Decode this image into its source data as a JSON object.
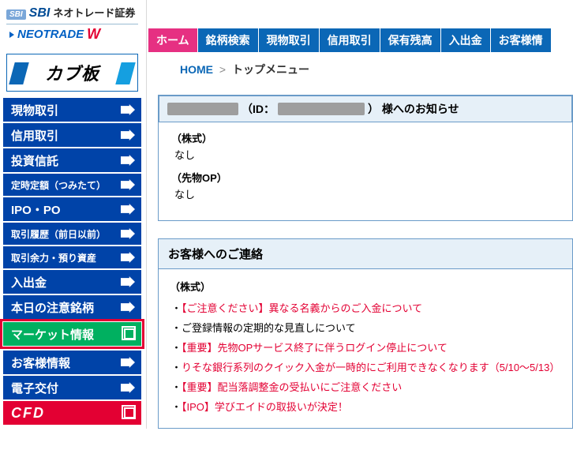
{
  "brand": {
    "mark": "SBI",
    "main": "SBI",
    "jp": "ネオトレード証券",
    "neo": "NEOTRADE",
    "neoSuffix": "W"
  },
  "kabu": "カブ板",
  "sidenav": [
    {
      "label": "現物取引",
      "style": "std"
    },
    {
      "label": "信用取引",
      "style": "std"
    },
    {
      "label": "投資信託",
      "style": "std"
    },
    {
      "label": "定時定額（つみたて）",
      "style": "small"
    },
    {
      "label": "IPO・PO",
      "style": "std"
    },
    {
      "label": "取引履歴（前日以前）",
      "style": "small"
    },
    {
      "label": "取引余力・預り資産",
      "style": "small"
    },
    {
      "label": "入出金",
      "style": "std"
    },
    {
      "label": "本日の注意銘柄",
      "style": "std"
    },
    {
      "label": "マーケット情報",
      "style": "market"
    },
    {
      "label": "お客様情報",
      "style": "std"
    },
    {
      "label": "電子交付",
      "style": "std"
    },
    {
      "label": "CFD",
      "style": "cfd"
    }
  ],
  "topnav": [
    {
      "label": "ホーム",
      "active": true
    },
    {
      "label": "銘柄検索",
      "active": false
    },
    {
      "label": "現物取引",
      "active": false
    },
    {
      "label": "信用取引",
      "active": false
    },
    {
      "label": "保有残高",
      "active": false
    },
    {
      "label": "入出金",
      "active": false
    },
    {
      "label": "お客様情",
      "active": false
    }
  ],
  "breadcrumb": {
    "home": "HOME",
    "sep": ">",
    "current": "トップメニュー"
  },
  "notice": {
    "id_prefix": "（ID：",
    "id_suffix": "） 様へのお知らせ",
    "sections": [
      {
        "title": "（株式）",
        "body": "なし"
      },
      {
        "title": "（先物OP）",
        "body": "なし"
      }
    ]
  },
  "messages": {
    "head": "お客様へのご連絡",
    "group": "（株式）",
    "items": [
      {
        "t": "【ご注意ください】異なる名義からのご入金について",
        "c": "red"
      },
      {
        "t": "ご登録情報の定期的な見直しについて",
        "c": "blk"
      },
      {
        "t": "【重要】先物OPサービス終了に伴うログイン停止について",
        "c": "red"
      },
      {
        "t": "りそな銀行系列のクイック入金が一時的にご利用できなくなります（5/10～5/13）",
        "c": "red"
      },
      {
        "t": "【重要】配当落調整金の受払いにご注意ください",
        "c": "red"
      },
      {
        "t": "【IPO】学びエイドの取扱いが決定！",
        "c": "red"
      }
    ]
  }
}
